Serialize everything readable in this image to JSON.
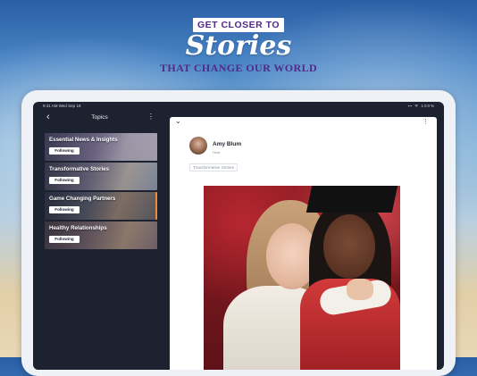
{
  "promo": {
    "line1": "GET CLOSER TO",
    "line2": "Stories",
    "line3": "THAT CHANGE OUR WORLD"
  },
  "status_bar": {
    "time": "9:41 AM  Wed Sep 18",
    "indicators": "▪▪ ᯤ 100%"
  },
  "left_panel": {
    "title": "Topics",
    "topics": [
      {
        "name": "Essential News & Insights",
        "follow_label": "Following"
      },
      {
        "name": "Transformative Stories",
        "follow_label": "Following"
      },
      {
        "name": "Game Changing Partners",
        "follow_label": "Following"
      },
      {
        "name": "Healthy Relationships",
        "follow_label": "Following"
      }
    ]
  },
  "post": {
    "author": "Amy Blum",
    "role": "Host",
    "tag": "Transformative Stories"
  },
  "icons": {
    "back": "chevron-left-icon",
    "more": "vertical-ellipsis-icon",
    "collapse": "chevron-down-icon"
  },
  "colors": {
    "brand_purple": "#4f2a87",
    "screen_dark": "#1d2230",
    "accent": "#f08a3a"
  }
}
